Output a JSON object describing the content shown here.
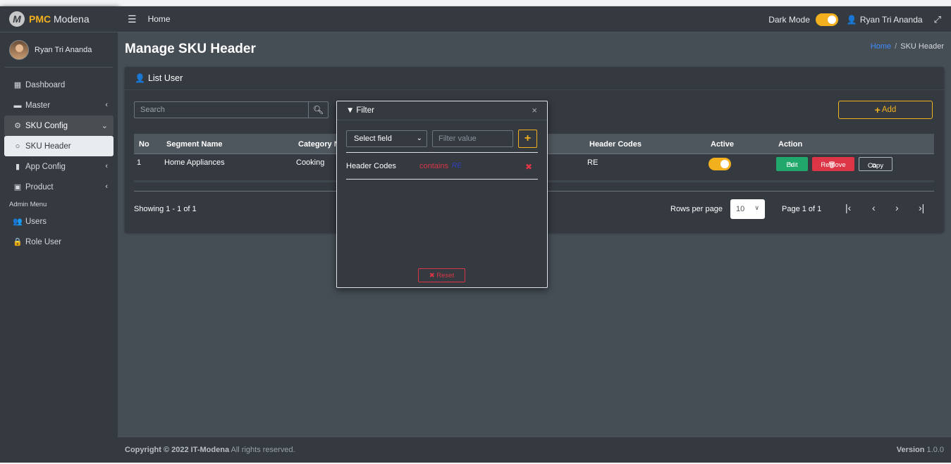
{
  "brand": {
    "logo_letter": "M",
    "name_part1": "PMC",
    "name_part2": "Modena"
  },
  "sidebar": {
    "user_name": "Ryan Tri Ananda",
    "items": [
      {
        "label": "Dashboard",
        "icon": "grid-icon"
      },
      {
        "label": "Master",
        "icon": "car-icon"
      },
      {
        "label": "SKU Config",
        "icon": "gear-icon"
      },
      {
        "label": "SKU Header",
        "icon": "circle-icon"
      },
      {
        "label": "App Config",
        "icon": "mobile-icon"
      },
      {
        "label": "Product",
        "icon": "briefcase-icon"
      }
    ],
    "section_header": "Admin Menu",
    "admin_items": [
      {
        "label": "Users",
        "icon": "users-icon"
      },
      {
        "label": "Role User",
        "icon": "lock-icon"
      }
    ]
  },
  "topnav": {
    "home": "Home",
    "dark_mode_label": "Dark Mode",
    "dark_mode_on": true,
    "user": "Ryan Tri Ananda"
  },
  "page": {
    "title": "Manage SKU Header",
    "breadcrumb": {
      "home": "Home",
      "separator": "/",
      "current": "SKU Header"
    }
  },
  "card": {
    "title": "List User",
    "search_placeholder": "Search",
    "add_label": "Add",
    "columns": [
      "No",
      "Segment Name",
      "Category N",
      "Header Codes",
      "Active",
      "Action"
    ],
    "rows": [
      {
        "no": "1",
        "segment": "Home Appliances",
        "category": "Cooking",
        "header_codes": "RE",
        "active": true
      }
    ],
    "actions": {
      "edit": "Edit",
      "remove": "Remove",
      "copy": "Copy"
    },
    "showing": "Showing 1 - 1 of 1",
    "rows_per_page_label": "Rows per page",
    "rows_per_page_value": "10",
    "page_info": "Page 1 of 1"
  },
  "filter": {
    "title": "Filter",
    "select_field": "Select field",
    "value_placeholder": "Filter value",
    "rule": {
      "field": "Header Codes",
      "operator": "contains",
      "value": "RE"
    },
    "reset_label": "Reset"
  },
  "footer": {
    "copyright_prefix": "Copyright © 2022 IT-Modena",
    "copyright_suffix": "All rights reserved.",
    "version_label": "Version",
    "version_value": "1.0.0"
  },
  "colors": {
    "accent": "#f2b01e",
    "danger": "#dc3545",
    "success": "#20a86a",
    "sidebar_bg": "#343a40",
    "content_bg": "#454d55"
  }
}
